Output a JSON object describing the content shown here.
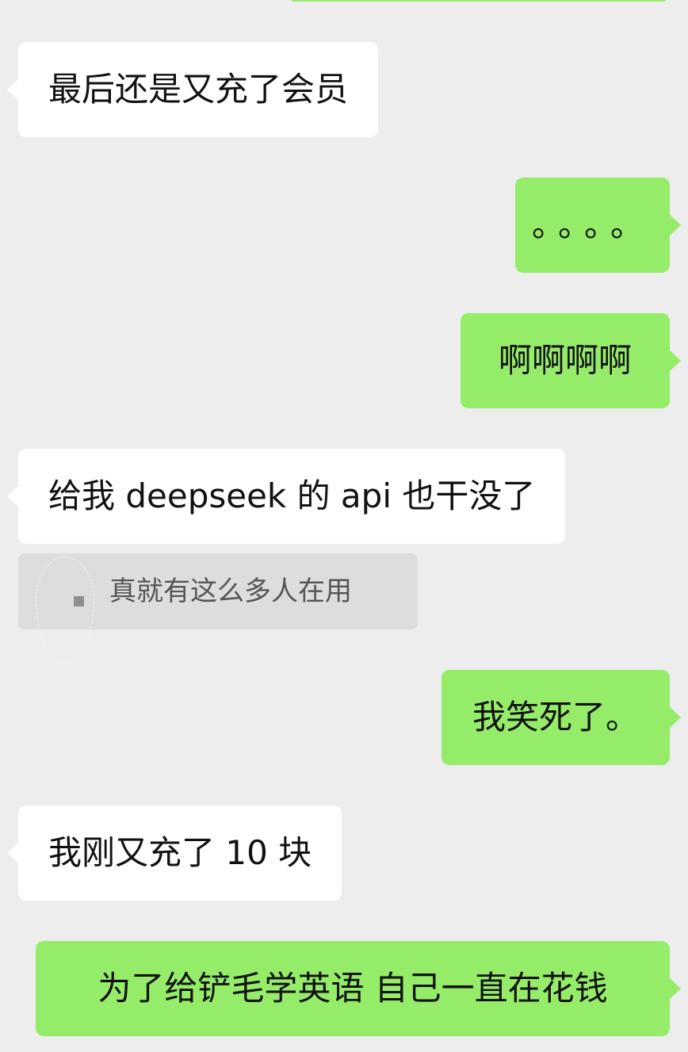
{
  "messages": [
    {
      "direction": "incoming",
      "text": "最后还是又充了会员"
    },
    {
      "direction": "outgoing",
      "text": "。。。。"
    },
    {
      "direction": "outgoing",
      "text": "啊啊啊啊"
    },
    {
      "direction": "incoming",
      "text": "给我 deepseek 的 api 也干没了"
    },
    {
      "direction": "quote",
      "text": "真就有这么多人在用"
    },
    {
      "direction": "outgoing",
      "text": "我笑死了。"
    },
    {
      "direction": "incoming",
      "text": "我刚又充了 10 块"
    },
    {
      "direction": "outgoing",
      "text": "为了给铲毛学英语 自己一直在花钱"
    }
  ],
  "colors": {
    "background": "#ededed",
    "incoming_bubble": "#ffffff",
    "outgoing_bubble": "#95ec69",
    "quote_bubble": "#dddddd",
    "text": "#111111"
  }
}
